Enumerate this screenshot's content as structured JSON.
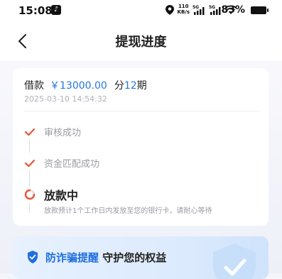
{
  "status_bar": {
    "time": "15:08",
    "net_speed_top": "110",
    "net_speed_bottom": "KB/s",
    "signal1_label": "5G",
    "signal2_label": "5G",
    "battery": "83%"
  },
  "nav": {
    "title": "提现进度"
  },
  "loan": {
    "label": "借款",
    "amount": "￥13000.00",
    "term_prefix": "分",
    "term_value": "12",
    "term_suffix": "期",
    "datetime": "2025-03-10 14:54:32"
  },
  "steps": [
    {
      "label": "审核成功",
      "state": "done"
    },
    {
      "label": "资金匹配成功",
      "state": "done"
    },
    {
      "label": "放款中",
      "state": "active",
      "desc": "放款预计1个工作日内发放至您的银行卡，请耐心等待"
    }
  ],
  "banner": {
    "highlight": "防诈骗提醒",
    "rest": " 守护您的权益"
  },
  "colors": {
    "accent_blue": "#2277dd",
    "check_red": "#e6543b",
    "banner_blue": "#1f6fe0"
  }
}
